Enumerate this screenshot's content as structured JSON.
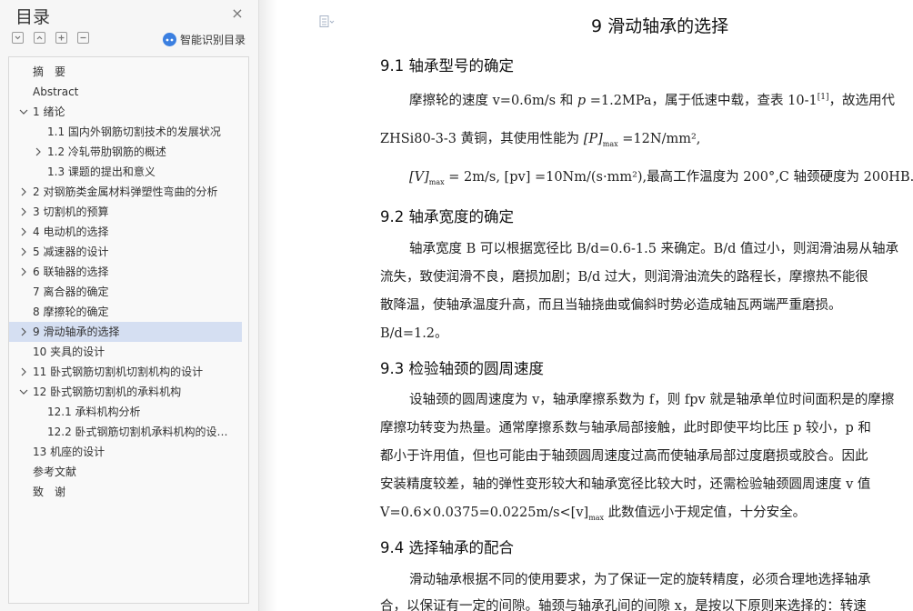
{
  "sidebar": {
    "title": "目录",
    "close_icon": "×",
    "smart_label": "智能识别目录",
    "items": [
      {
        "label": "摘　要",
        "level": 1,
        "chevron": ""
      },
      {
        "label": "Abstract",
        "level": 1,
        "chevron": ""
      },
      {
        "label": "1  绪论",
        "level": 1,
        "chevron": "down"
      },
      {
        "label": "1.1  国内外钢筋切割技术的发展状况",
        "level": 2,
        "chevron": ""
      },
      {
        "label": "1.2  冷轧带肋钢筋的概述",
        "level": 2,
        "chevron": "right"
      },
      {
        "label": "1.3  课题的提出和意义",
        "level": 2,
        "chevron": ""
      },
      {
        "label": "2  对钢筋类金属材料弹塑性弯曲的分析",
        "level": 1,
        "chevron": "right"
      },
      {
        "label": "3  切割机的预算",
        "level": 1,
        "chevron": "right"
      },
      {
        "label": "4  电动机的选择",
        "level": 1,
        "chevron": "right"
      },
      {
        "label": "5  减速器的设计",
        "level": 1,
        "chevron": "right"
      },
      {
        "label": "6  联轴器的选择",
        "level": 1,
        "chevron": "right"
      },
      {
        "label": "7  离合器的确定",
        "level": 1,
        "chevron": ""
      },
      {
        "label": "8  摩擦轮的确定",
        "level": 1,
        "chevron": ""
      },
      {
        "label": "9  滑动轴承的选择",
        "level": 1,
        "chevron": "right",
        "active": true
      },
      {
        "label": "10  夹具的设计",
        "level": 1,
        "chevron": ""
      },
      {
        "label": "11  卧式钢筋切割机切割机构的设计",
        "level": 1,
        "chevron": "right"
      },
      {
        "label": "12  卧式钢筋切割机的承料机构",
        "level": 1,
        "chevron": "down"
      },
      {
        "label": "12.1  承料机构分析",
        "level": 2,
        "chevron": ""
      },
      {
        "label": "12.2  卧式钢筋切割机承料机构的设…",
        "level": 2,
        "chevron": ""
      },
      {
        "label": "13  机座的设计",
        "level": 1,
        "chevron": ""
      },
      {
        "label": "参考文献",
        "level": 1,
        "chevron": ""
      },
      {
        "label": "致　谢",
        "level": 1,
        "chevron": ""
      }
    ]
  },
  "document": {
    "chapter_title": "9  滑动轴承的选择",
    "s1_heading": "9.1  轴承型号的确定",
    "p1a_pre": "摩擦轮的速度 v=0.6m/s 和 ",
    "p1a_p": "p",
    "p1a_mid": " =1.2MPa，属于低速中载，查表 10-1",
    "p1a_ref": "[1]",
    "p1a_post": "，故选用代",
    "p1b_pre": "ZHSi80-3-3 黄铜，其使用性能为 ",
    "p1b_sym": "[P]",
    "p1b_sub": "max",
    "p1b_post": " =12N/mm²,",
    "p1c_sym": "[V]",
    "p1c_sub": "max",
    "p1c_post": " = 2m/s, [pv] =10Nm/(s·mm²),最高工作温度为 200°,C 轴颈硬度为 200HB.",
    "s2_heading": "9.2  轴承宽度的确定",
    "p2a": "轴承宽度 B 可以根据宽径比 B/d=0.6-1.5 来确定。B/d 值过小，则润滑油易从轴承",
    "p2b": "流失，致使润滑不良，磨损加剧；B/d 过大，则润滑油流失的路程长，摩擦热不能很",
    "p2c": "散降温，使轴承温度升高，而且当轴挠曲或偏斜时势必造成轴瓦两端严重磨损。",
    "p2d": "B/d=1.2。",
    "s3_heading": "9.3  检验轴颈的圆周速度",
    "p3a": "设轴颈的圆周速度为 v，轴承摩擦系数为 f，则 fpv 就是轴承单位时间面积是的摩擦",
    "p3b": "摩擦功转变为热量。通常摩擦系数与轴承局部接触，此时即使平均比压 p 较小，p 和",
    "p3c": "都小于许用值，但也可能由于轴颈圆周速度过高而使轴承局部过度磨损或胶合。因此",
    "p3d": "安装精度较差，轴的弹性变形较大和轴承宽径比较大时，还需检验轴颈圆周速度 v 值",
    "p3e_pre": "V=0.6×0.0375=0.0225m/s<[v]",
    "p3e_sub": "max",
    "p3e_post": "   此数值远小于规定值，十分安全。",
    "s4_heading": "9.4 选择轴承的配合",
    "p4a": "滑动轴承根据不同的使用要求，为了保证一定的旋转精度，必须合理地选择轴承",
    "p4b": "合，以保证有一定的间隙。轴颈与轴承孔间的间隙 x，是按以下原则来选择的：转速"
  },
  "colors": {
    "accent": "#3b7fe0",
    "active_bg": "#d5dff2"
  }
}
